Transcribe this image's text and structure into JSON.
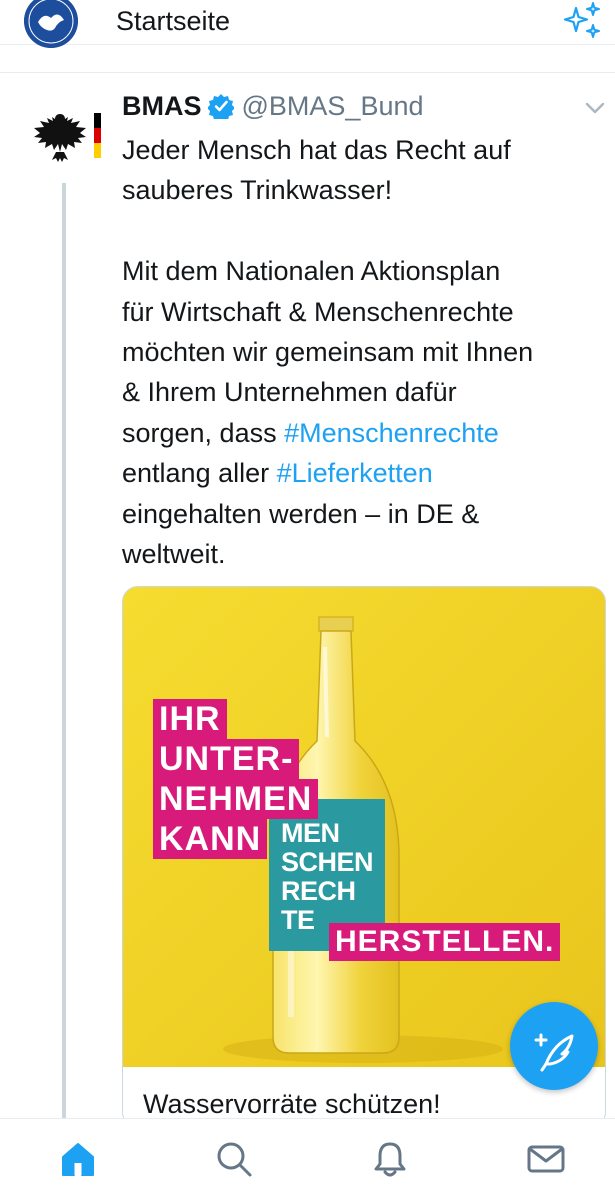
{
  "header": {
    "title": "Startseite",
    "avatar_icon": "nato-badge-avatar",
    "sparkle_icon": "sparkle-icon"
  },
  "tweet": {
    "display_name": "BMAS",
    "handle": "@BMAS_Bund",
    "verified": true,
    "text_line1": "Jeder Mensch hat das Recht auf",
    "text_line2": "sauberes Trinkwasser!",
    "text_p2_line1": "Mit dem Nationalen Aktionsplan",
    "text_p2_line2": "für Wirtschaft & Menschenrechte",
    "text_p2_line3": "möchten wir gemeinsam mit Ihnen",
    "text_p2_line4": "& Ihrem Unternehmen dafür",
    "text_p2_line5a": "sorgen, dass ",
    "hashtag1": "#Menschenrechte",
    "text_p2_line6a": "entlang aller ",
    "hashtag2": "#Lieferketten",
    "text_p2_line7": "eingehalten werden – in DE &",
    "text_p2_line8": "weltweit."
  },
  "card": {
    "title": "Wasservorräte schützen!",
    "image_text": {
      "line1": "IHR",
      "line2": "UNTER-",
      "line3": "NEHMEN",
      "line4": "KANN",
      "label1": "MEN",
      "label2": "SCHEN",
      "label3": "RECH",
      "label4": "TE",
      "line5": "HERSTELLEN."
    }
  },
  "nav": {
    "items": [
      {
        "name": "home",
        "icon": "home-icon",
        "active": true
      },
      {
        "name": "search",
        "icon": "search-icon",
        "active": false
      },
      {
        "name": "notifications",
        "icon": "bell-icon",
        "active": false
      },
      {
        "name": "messages",
        "icon": "mail-icon",
        "active": false
      }
    ]
  },
  "colors": {
    "accent": "#1da1f2",
    "card_bg": "#f2d528",
    "pink": "#d81b7a",
    "teal": "#2a9aa0"
  }
}
